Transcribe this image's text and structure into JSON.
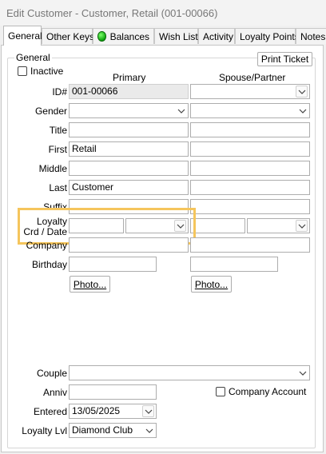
{
  "window": {
    "title": "Edit Customer - Customer, Retail (001-00066)"
  },
  "tabs": [
    "General",
    "Other Keys",
    "Balances",
    "Wish List",
    "Activity",
    "Loyalty Points",
    "Notes"
  ],
  "buttons": {
    "print_ticket": "Print Ticket",
    "photo_primary": "Photo...",
    "photo_spouse": "Photo..."
  },
  "group_label": "General",
  "inactive_label": "Inactive",
  "columns": {
    "primary": "Primary",
    "spouse": "Spouse/Partner"
  },
  "labels": {
    "id": "ID#",
    "gender": "Gender",
    "title": "Title",
    "first": "First",
    "middle": "Middle",
    "last": "Last",
    "suffix": "Suffix",
    "loyalty_line1": "Loyalty",
    "loyalty_line2": "Crd / Date",
    "company": "Company",
    "birthday": "Birthday",
    "couple": "Couple",
    "anniv": "Anniv",
    "entered": "Entered",
    "loyalty_lvl": "Loyalty Lvl"
  },
  "values": {
    "id": "001-00066",
    "first": "Retail",
    "last": "Customer",
    "entered": "13/05/2025",
    "loyalty_lvl": "Diamond Club"
  },
  "company_account_label": "Company Account",
  "colors": {
    "highlight": "#f5c55c",
    "balances_dot": "#1cc41c"
  }
}
